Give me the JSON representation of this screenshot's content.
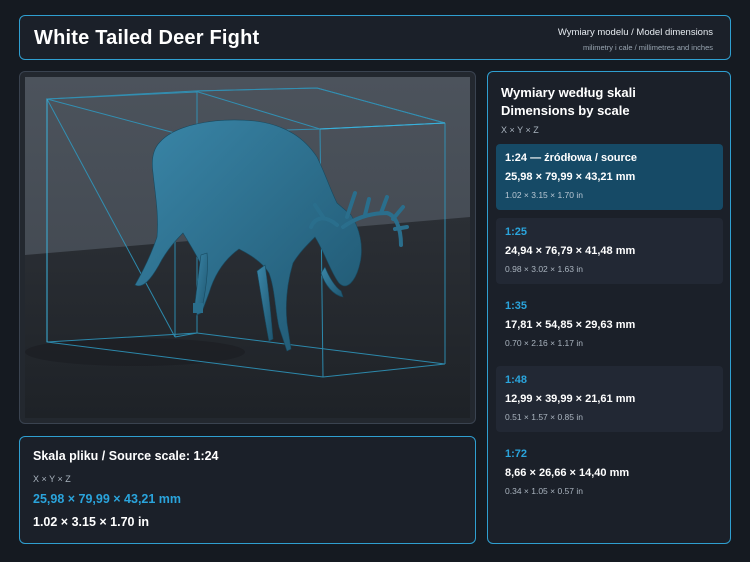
{
  "header": {
    "title": "White Tailed Deer Fight",
    "subtitle_line1": "Wymiary modelu / Model dimensions",
    "subtitle_line2": "milimetry i cale / millimetres and inches"
  },
  "source": {
    "title": "Skala pliku / Source scale: 1:24",
    "axes": "X × Y × Z",
    "mm": "25,98 × 79,99 × 43,21 mm",
    "in": "1.02 × 3.15 × 1.70 in"
  },
  "scales": {
    "title_line1": "Wymiary według skali",
    "title_line2": "Dimensions by scale",
    "axes": "X × Y × Z",
    "items": [
      {
        "label": "1:24  —  źródłowa / source",
        "mm": "25,98 × 79,99 × 43,21 mm",
        "in": "1.02 × 3.15 × 1.70 in",
        "active": true
      },
      {
        "label": "1:25",
        "mm": "24,94 × 76,79 × 41,48 mm",
        "in": "0.98 × 3.02 × 1.63 in"
      },
      {
        "label": "1:35",
        "mm": "17,81 × 54,85 × 29,63 mm",
        "in": "0.70 × 2.16 × 1.17 in"
      },
      {
        "label": "1:48",
        "mm": "12,99 × 39,99 × 21,61 mm",
        "in": "0.51 × 1.57 × 0.85 in"
      },
      {
        "label": "1:72",
        "mm": "8,66 × 26,66 × 14,40 mm",
        "in": "0.34 × 1.05 × 0.57 in"
      }
    ]
  },
  "colors": {
    "accent": "#2aa4dc",
    "panel_border": "#2f9fd0",
    "active_card": "#164a66",
    "model": "#2a6e8c"
  }
}
